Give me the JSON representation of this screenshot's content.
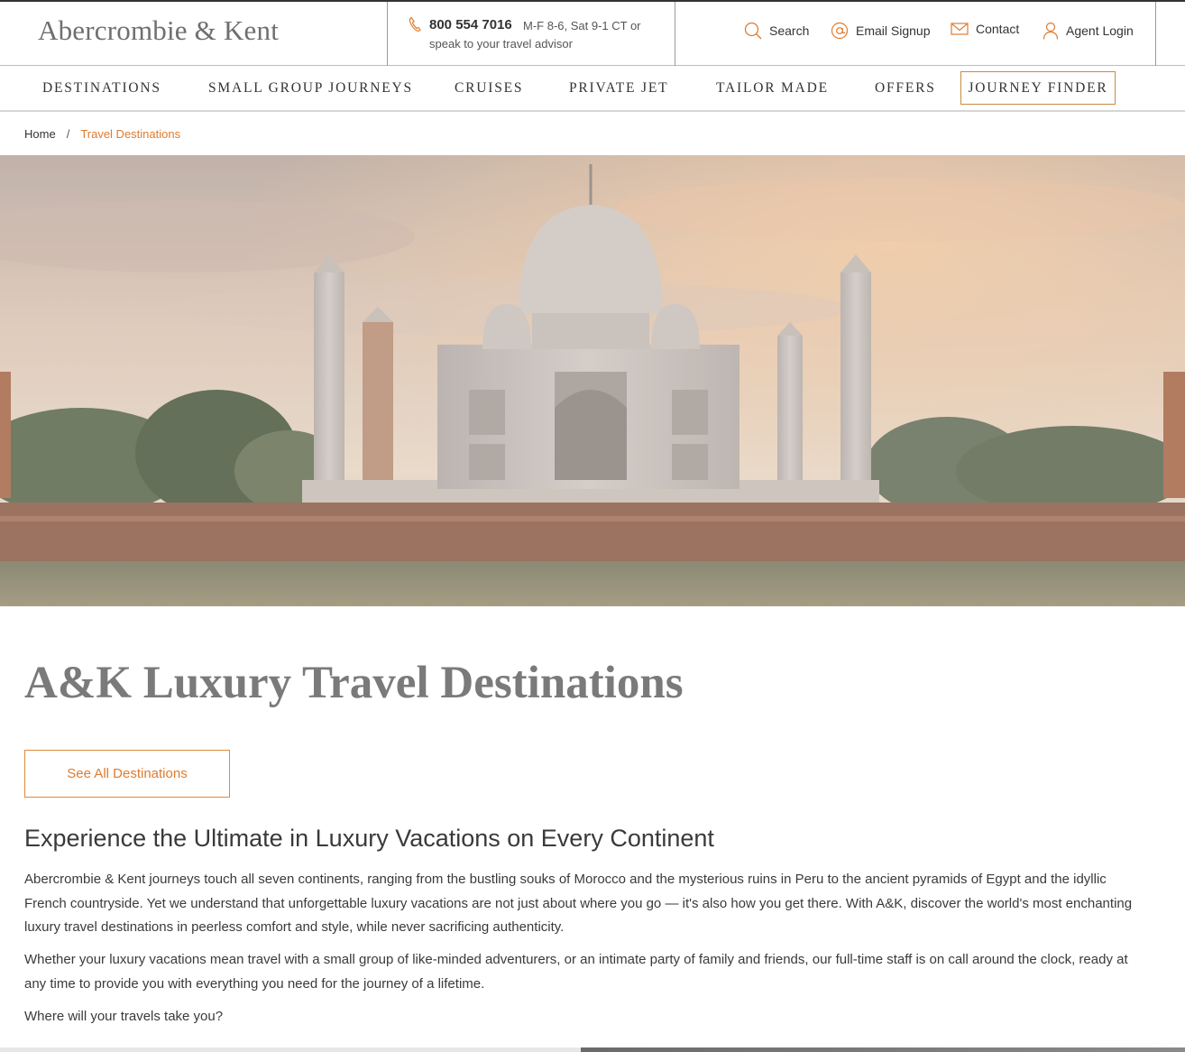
{
  "header": {
    "logo": "Abercrombie & Kent",
    "phone_number": "800 554 7016",
    "phone_hours": "M-F 8-6, Sat 9-1 CT or",
    "phone_advisor": "speak to your travel advisor",
    "utility": {
      "search": "Search",
      "email_signup": "Email Signup",
      "contact": "Contact",
      "agent_login": "Agent Login"
    }
  },
  "nav": {
    "items": [
      "DESTINATIONS",
      "SMALL GROUP JOURNEYS",
      "CRUISES",
      "PRIVATE JET",
      "TAILOR MADE",
      "OFFERS"
    ],
    "journey_finder": "JOURNEY FINDER"
  },
  "breadcrumb": {
    "home": "Home",
    "separator": "/",
    "current": "Travel Destinations"
  },
  "main": {
    "title": "A&K Luxury Travel Destinations",
    "cta": "See All Destinations",
    "subheading": "Experience the Ultimate in Luxury Vacations on Every Continent",
    "paragraphs": [
      "Abercrombie & Kent journeys touch all seven continents, ranging from the bustling souks of Morocco and the mysterious ruins in Peru to the ancient pyramids of Egypt and the idyllic French countryside. Yet we understand that unforgettable luxury vacations are not just about where you go — it's also how you get there. With A&K, discover the world's most enchanting luxury travel destinations in peerless comfort and style, while never sacrificing authenticity.",
      "Whether your luxury vacations mean travel with a small group of like-minded adventurers, or an intimate party of family and friends, our full-time staff is on call around the clock, ready at any time to provide you with everything you need for the journey of a lifetime.",
      "Where will your travels take you?"
    ]
  },
  "colors": {
    "accent": "#e07b2e",
    "accent_border": "#c98a3e",
    "text": "#3a3a3a",
    "title": "#7a7a7a"
  },
  "icons": {
    "phone": "phone-icon",
    "search": "search-icon",
    "email": "at-sign-icon",
    "contact": "envelope-icon",
    "agent": "user-icon"
  }
}
